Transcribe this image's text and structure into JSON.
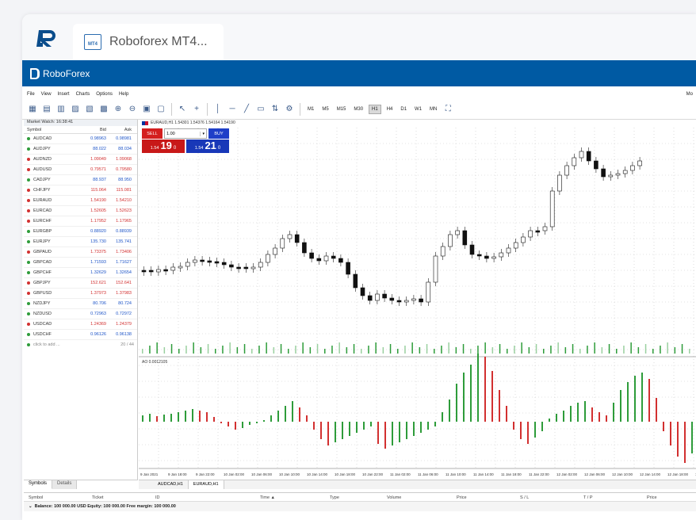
{
  "browser": {
    "tab_title": "Roboforex MT4...",
    "tab_icon": "mt4-icon",
    "tab_icon_text": "MT4"
  },
  "header": {
    "brand": "RoboForex"
  },
  "menu": [
    "File",
    "View",
    "Insert",
    "Charts",
    "Options",
    "Help"
  ],
  "menu_right": "Mo",
  "toolbar": {
    "timeframes": [
      "M1",
      "M5",
      "M15",
      "M30",
      "H1",
      "H4",
      "D1",
      "W1",
      "MN"
    ],
    "active_timeframe": "H1"
  },
  "market_watch": {
    "title": "Market Watch: 16:38:41",
    "headers": {
      "symbol": "Symbol",
      "bid": "Bid",
      "ask": "Ask"
    },
    "rows": [
      {
        "symbol": "AUDCAD",
        "bid": "0.98963",
        "ask": "0.98981",
        "dir": "up"
      },
      {
        "symbol": "AUDJPY",
        "bid": "88.022",
        "ask": "88.034",
        "dir": "up"
      },
      {
        "symbol": "AUDNZD",
        "bid": "1.09049",
        "ask": "1.09068",
        "dir": "down"
      },
      {
        "symbol": "AUDUSD",
        "bid": "0.79571",
        "ask": "0.79580",
        "dir": "down"
      },
      {
        "symbol": "CADJPY",
        "bid": "88.937",
        "ask": "88.950",
        "dir": "up"
      },
      {
        "symbol": "CHFJPY",
        "bid": "115.064",
        "ask": "115.081",
        "dir": "down"
      },
      {
        "symbol": "EURAUD",
        "bid": "1.54190",
        "ask": "1.54210",
        "dir": "down"
      },
      {
        "symbol": "EURCAD",
        "bid": "1.52605",
        "ask": "1.52623",
        "dir": "down"
      },
      {
        "symbol": "EURCHF",
        "bid": "1.17952",
        "ask": "1.17965",
        "dir": "down"
      },
      {
        "symbol": "EURGBP",
        "bid": "0.88920",
        "ask": "0.88939",
        "dir": "up"
      },
      {
        "symbol": "EURJPY",
        "bid": "135.730",
        "ask": "135.741",
        "dir": "up"
      },
      {
        "symbol": "GBPAUD",
        "bid": "1.73375",
        "ask": "1.73406",
        "dir": "down"
      },
      {
        "symbol": "GBPCAD",
        "bid": "1.71593",
        "ask": "1.71627",
        "dir": "up"
      },
      {
        "symbol": "GBPCHF",
        "bid": "1.32629",
        "ask": "1.32654",
        "dir": "up"
      },
      {
        "symbol": "GBPJPY",
        "bid": "152.621",
        "ask": "152.641",
        "dir": "down"
      },
      {
        "symbol": "GBPUSD",
        "bid": "1.37973",
        "ask": "1.37983",
        "dir": "down"
      },
      {
        "symbol": "NZDJPY",
        "bid": "80.706",
        "ask": "80.724",
        "dir": "up"
      },
      {
        "symbol": "NZDUSD",
        "bid": "0.72963",
        "ask": "0.72972",
        "dir": "up"
      },
      {
        "symbol": "USDCAD",
        "bid": "1.24369",
        "ask": "1.24379",
        "dir": "down"
      },
      {
        "symbol": "USDCHF",
        "bid": "0.96126",
        "ask": "0.96138",
        "dir": "up"
      }
    ],
    "add_label": "click to add ...",
    "count": "20 / 44",
    "tabs": [
      "Symbols",
      "Details"
    ]
  },
  "chart": {
    "header": "EURAUD,H1  1.54301 1.54376 1.54164 1.54190",
    "one_click": {
      "sell_label": "SELL",
      "buy_label": "BUY",
      "lot": "1.00",
      "sell_prefix": "1.54",
      "sell_big": "19",
      "sell_sup": "0",
      "buy_prefix": "1.54",
      "buy_big": "21",
      "buy_sup": "0"
    },
    "indicator_label": "AO 0.0012105",
    "x_ticks": [
      "9 Jan 2021",
      "9 Jan 18:00",
      "9 Jan 22:00",
      "10 Jan 02:00",
      "10 Jan 06:00",
      "10 Jan 10:00",
      "10 Jan 14:00",
      "10 Jan 18:00",
      "10 Jan 22:00",
      "11 Jan 02:00",
      "11 Jan 06:00",
      "11 Jan 10:00",
      "11 Jan 14:00",
      "11 Jan 18:00",
      "11 Jan 22:00",
      "12 Jan 02:00",
      "12 Jan 06:00",
      "12 Jan 10:00",
      "12 Jan 14:00",
      "12 Jan 18:00",
      "12 Jan 22:00"
    ],
    "tabs": [
      "AUDCAD,H1",
      "EURAUD,H1"
    ],
    "active_tab": "EURAUD,H1",
    "colors": {
      "up_bar": "#2e9c3a",
      "down_bar": "#d23030",
      "grid": "#c8c8c8"
    }
  },
  "terminal": {
    "headers": [
      "Symbol",
      "Ticket",
      "ID",
      "Time ▲",
      "Type",
      "Volume",
      "Price",
      "S / L",
      "T / P",
      "Price"
    ],
    "balance": "Balance: 100 000.00 USD  Equity: 100 000.00  Free margin: 100 000.00"
  }
}
